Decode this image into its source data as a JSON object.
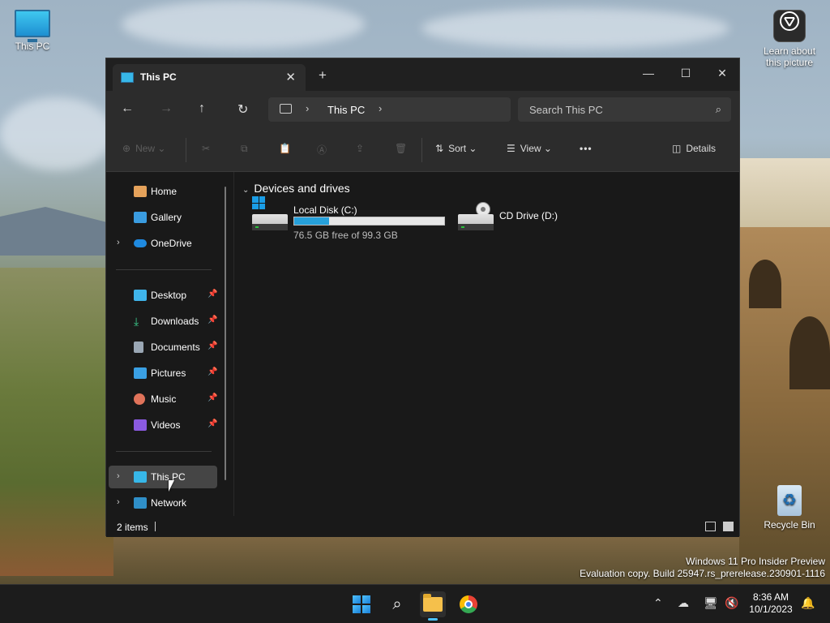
{
  "desktop": {
    "this_pc_label": "This PC",
    "learn_label": "Learn about this picture",
    "recycle_label": "Recycle Bin",
    "watermark_line1": "Windows 11 Pro Insider Preview",
    "watermark_line2": "Evaluation copy. Build 25947.rs_prerelease.230901-1116"
  },
  "window": {
    "tab_title": "This PC",
    "tab_close": "✕",
    "new_tab": "+",
    "minimize": "—",
    "maximize": "☐",
    "close": "✕"
  },
  "nav": {
    "back": "←",
    "forward": "→",
    "up": "↑",
    "refresh": "↻",
    "breadcrumb": "This PC",
    "search_placeholder": "Search This PC"
  },
  "command_bar": {
    "new_label": "New",
    "sort_label": "Sort",
    "view_label": "View",
    "more": "•••",
    "details_label": "Details"
  },
  "sidebar": {
    "items": [
      {
        "label": "Home"
      },
      {
        "label": "Gallery"
      },
      {
        "label": "OneDrive"
      },
      {
        "label": "Desktop"
      },
      {
        "label": "Downloads"
      },
      {
        "label": "Documents"
      },
      {
        "label": "Pictures"
      },
      {
        "label": "Music"
      },
      {
        "label": "Videos"
      },
      {
        "label": "This PC"
      },
      {
        "label": "Network"
      }
    ]
  },
  "content": {
    "group_title": "Devices and drives",
    "drives": [
      {
        "name": "Local Disk (C:)",
        "free": "76.5 GB free of 99.3 GB",
        "used_fraction": 0.23
      },
      {
        "name": "CD Drive (D:)"
      }
    ]
  },
  "status": {
    "item_count": "2 items"
  },
  "taskbar": {
    "time": "8:36 AM",
    "date": "10/1/2023"
  },
  "colors": {
    "accent": "#26a0da",
    "window_bg": "#191919",
    "toolbar_bg": "#2c2c2c"
  }
}
